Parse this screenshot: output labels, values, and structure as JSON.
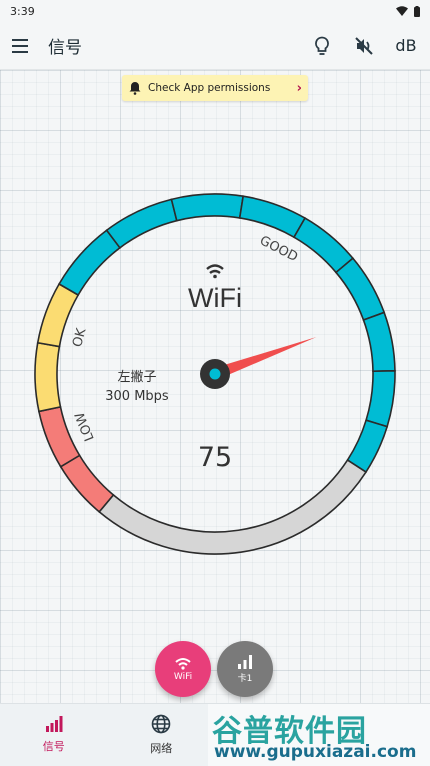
{
  "status_bar": {
    "time": "3:39"
  },
  "app_bar": {
    "title": "信号",
    "db_label": "dB"
  },
  "permission_chip": {
    "label": "Check App permissions"
  },
  "gauge": {
    "network_label": "WiFi",
    "ssid": "左撇子",
    "link_speed": "300 Mbps",
    "value": 75,
    "value_text": "75",
    "zones": [
      {
        "label": "LOW",
        "color": "#f47c78"
      },
      {
        "label": "OK",
        "color": "#fbdc72"
      },
      {
        "label": "GOOD",
        "color": "#00bcd4"
      }
    ],
    "inactive_color": "#d6d6d6",
    "needle_color": "#f04e4e"
  },
  "fabs": [
    {
      "label": "WiFi",
      "color": "#e83e7a"
    },
    {
      "label": "卡1",
      "color": "#7a7a7a"
    }
  ],
  "bottom_nav": [
    {
      "label": "信号",
      "active": true
    },
    {
      "label": "网络",
      "active": false
    }
  ],
  "watermark": {
    "top": "谷普软件园",
    "bottom": "www.gupuxiazai.com"
  }
}
